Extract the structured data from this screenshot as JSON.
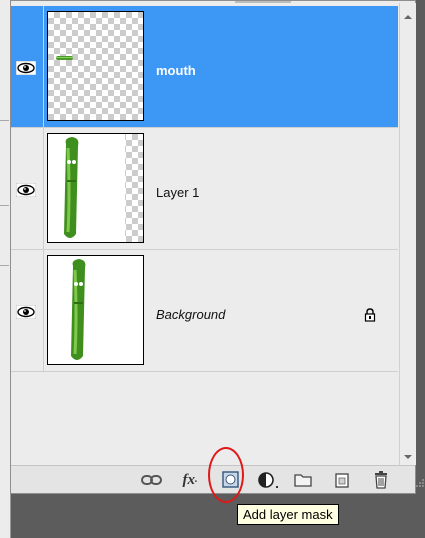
{
  "layers_panel": {
    "layers": [
      {
        "name": "mouth",
        "selected": true,
        "visible": true,
        "locked": false,
        "thumbnail": "transparent-with-green-mouth"
      },
      {
        "name": "Layer 1",
        "selected": false,
        "visible": true,
        "locked": false,
        "thumbnail": "cucumber-with-transparent-edge"
      },
      {
        "name": "Background",
        "selected": false,
        "visible": true,
        "locked": true,
        "thumbnail": "cucumber-on-white"
      }
    ],
    "toolbar": {
      "buttons": [
        {
          "icon": "link-layers-icon"
        },
        {
          "icon": "fx-icon",
          "label": "fx"
        },
        {
          "icon": "layer-mask-icon"
        },
        {
          "icon": "adjustment-layer-icon"
        },
        {
          "icon": "folder-icon"
        },
        {
          "icon": "new-layer-icon"
        },
        {
          "icon": "trash-icon"
        }
      ]
    },
    "tooltip": "Add layer mask",
    "colors": {
      "selected_row": "#3d97f4",
      "annotation_circle": "#e01818",
      "tooltip_bg": "#ffffe1"
    }
  }
}
